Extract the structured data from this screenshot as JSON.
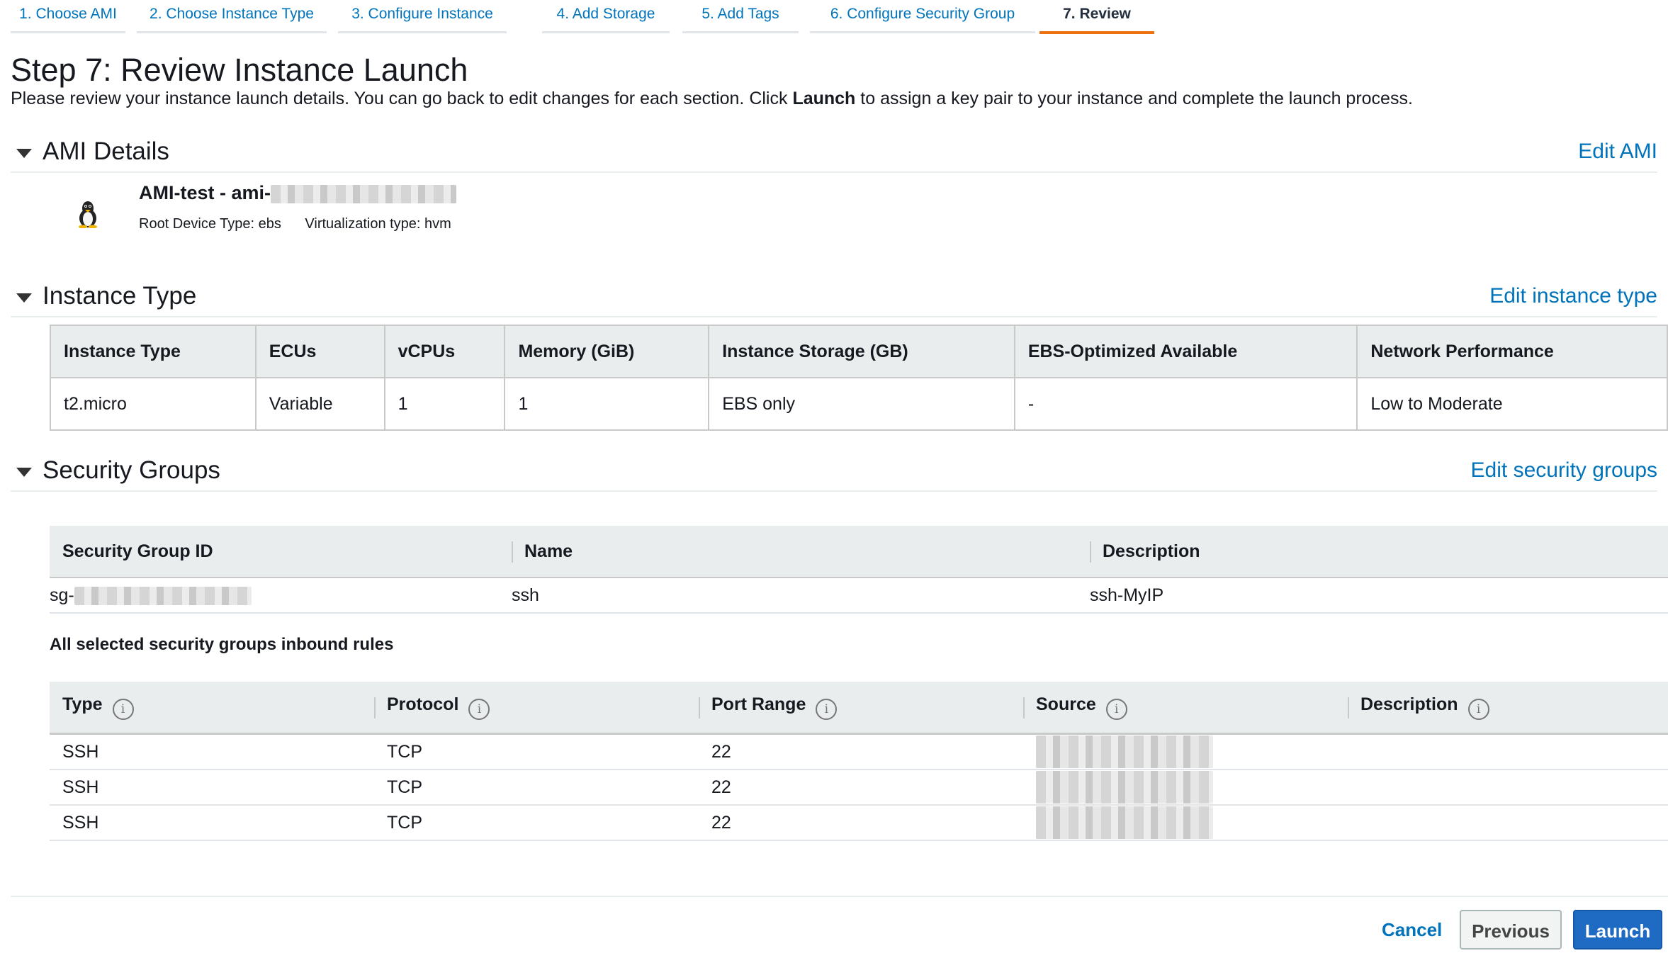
{
  "wizard": {
    "steps": [
      {
        "label": "1. Choose AMI"
      },
      {
        "label": "2. Choose Instance Type"
      },
      {
        "label": "3. Configure Instance"
      },
      {
        "label": "4. Add Storage"
      },
      {
        "label": "5. Add Tags"
      },
      {
        "label": "6. Configure Security Group"
      },
      {
        "label": "7. Review"
      }
    ],
    "active_step": "7. Review"
  },
  "page": {
    "title": "Step 7: Review Instance Launch",
    "intro_before": "Please review your instance launch details. You can go back to edit changes for each section. Click ",
    "intro_bold": "Launch",
    "intro_after": " to assign a key pair to your instance and complete the launch process."
  },
  "ami": {
    "section_title": "AMI Details",
    "edit_label": "Edit AMI",
    "icon": "linux-penguin-icon",
    "name_prefix": "AMI-test - ami-",
    "root_device": "Root Device Type: ebs",
    "virtualization": "Virtualization type: hvm"
  },
  "instance_type": {
    "section_title": "Instance Type",
    "edit_label": "Edit instance type",
    "columns": [
      "Instance Type",
      "ECUs",
      "vCPUs",
      "Memory (GiB)",
      "Instance Storage (GB)",
      "EBS-Optimized Available",
      "Network Performance"
    ],
    "row": [
      "t2.micro",
      "Variable",
      "1",
      "1",
      "EBS only",
      "-",
      "Low to Moderate"
    ]
  },
  "security_groups": {
    "section_title": "Security Groups",
    "edit_label": "Edit security groups",
    "columns": [
      "Security Group ID",
      "Name",
      "Description"
    ],
    "row": {
      "id_prefix": "sg-",
      "name": "ssh",
      "description": "ssh-MyIP"
    },
    "rules_label": "All selected security groups inbound rules",
    "rule_columns": [
      "Type",
      "Protocol",
      "Port Range",
      "Source",
      "Description"
    ],
    "rules": [
      {
        "type": "SSH",
        "protocol": "TCP",
        "port": "22",
        "description": ""
      },
      {
        "type": "SSH",
        "protocol": "TCP",
        "port": "22",
        "description": ""
      },
      {
        "type": "SSH",
        "protocol": "TCP",
        "port": "22",
        "description": ""
      }
    ],
    "info_glyph": "i"
  },
  "footer": {
    "cancel": "Cancel",
    "previous": "Previous",
    "launch": "Launch"
  },
  "colors": {
    "link": "#0073bb",
    "active_tab": "#ec7211",
    "primary_button": "#1f6bc4"
  }
}
